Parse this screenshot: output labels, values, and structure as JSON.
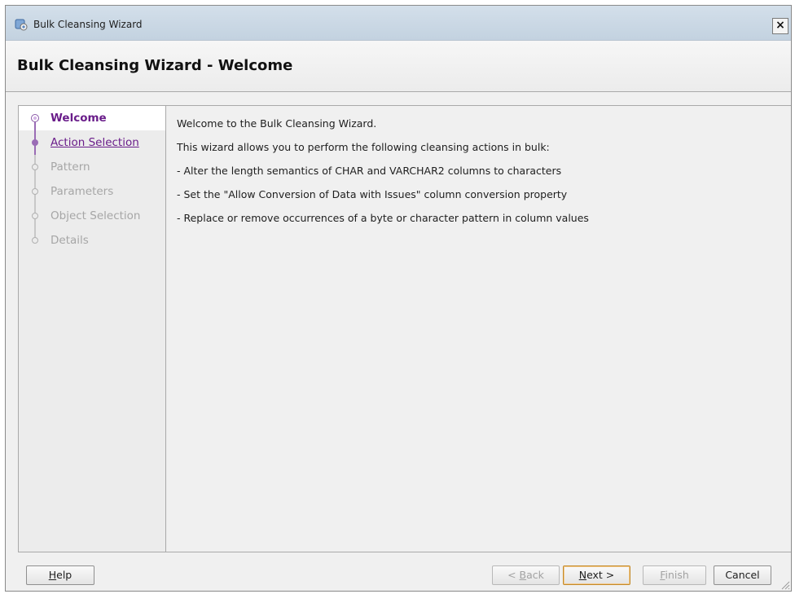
{
  "window": {
    "title": "Bulk Cleansing Wizard",
    "close_symbol": "×"
  },
  "header": {
    "title": "Bulk Cleansing Wizard - Welcome"
  },
  "nav": {
    "items": [
      {
        "label": "Welcome",
        "state": "active"
      },
      {
        "label": "Action Selection",
        "state": "link"
      },
      {
        "label": "Pattern",
        "state": "disabled"
      },
      {
        "label": "Parameters",
        "state": "disabled"
      },
      {
        "label": "Object Selection",
        "state": "disabled"
      },
      {
        "label": "Details",
        "state": "disabled"
      }
    ]
  },
  "content": {
    "lines": [
      "Welcome to the Bulk Cleansing Wizard.",
      "This wizard allows you to perform the following cleansing actions in bulk:",
      "- Alter the length semantics of CHAR and VARCHAR2 columns to characters",
      "- Set the \"Allow Conversion of Data with Issues\" column conversion property",
      "- Replace or remove occurrences of a byte or character pattern in column values"
    ]
  },
  "buttons": {
    "help": {
      "mnemonic": "H",
      "rest": "elp"
    },
    "back": {
      "prefix": "< ",
      "mnemonic": "B",
      "rest": "ack"
    },
    "next": {
      "mnemonic": "N",
      "rest": "ext >"
    },
    "finish": {
      "mnemonic": "F",
      "rest": "inish"
    },
    "cancel": {
      "label": "Cancel"
    }
  },
  "colors": {
    "link_purple": "#6a1d8a",
    "disabled_gray": "#a6a6a6",
    "title_bar": "#c9d7e4"
  }
}
